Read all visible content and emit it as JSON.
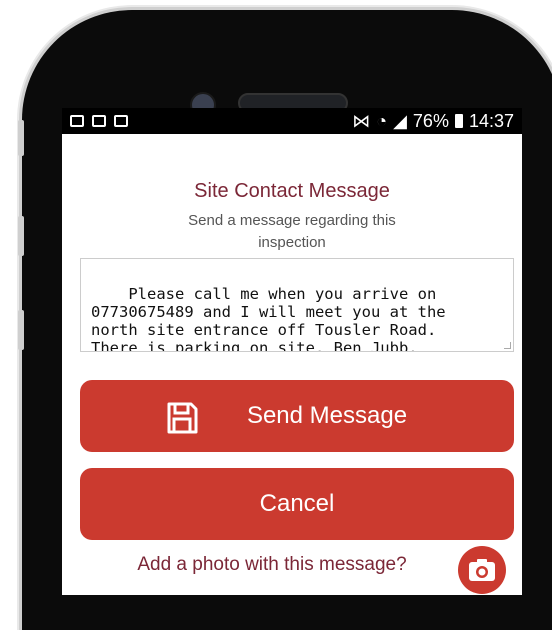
{
  "status_bar": {
    "battery": "76%",
    "time": "14:37"
  },
  "dialog": {
    "title": "Site Contact Message",
    "subtitle": "Send a message regarding this inspection",
    "message": "Please call me when you arrive on\n07730675489 and I will meet you at the\nnorth site entrance off Tousler Road.\nThere is parking on site. Ben Jubb.",
    "send_label": "Send Message",
    "cancel_label": "Cancel",
    "photo_link": "Add a photo with this message?"
  },
  "colors": {
    "accent": "#cb3a2f",
    "title": "#7b2737"
  },
  "icons": {
    "send": "save-icon",
    "photo": "camera-icon"
  }
}
